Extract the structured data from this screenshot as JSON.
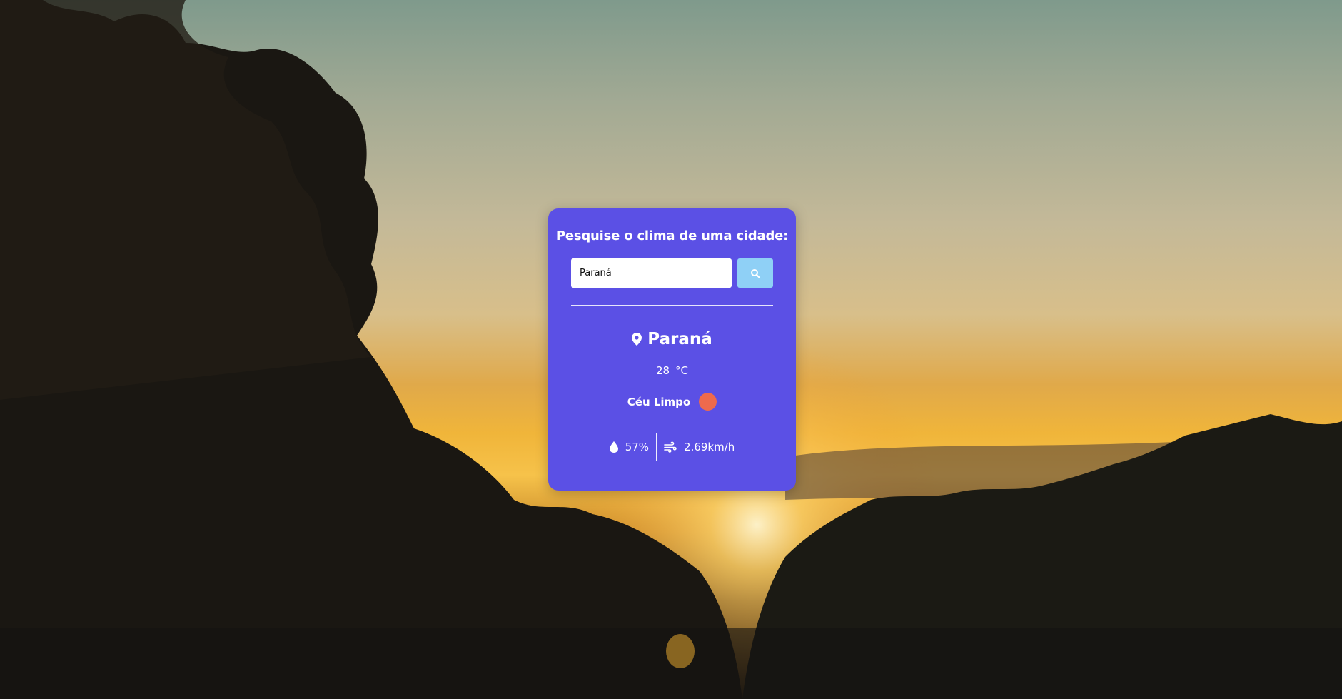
{
  "search": {
    "heading": "Pesquise o clima de uma cidade:",
    "input_value": "Paraná",
    "button_icon": "search-icon"
  },
  "weather": {
    "city": "Paraná",
    "city_icon": "location-pin-icon",
    "temperature": "28",
    "unit": "°C",
    "description": "Céu Limpo",
    "description_icon": "weather-condition-icon",
    "humidity": "57%",
    "humidity_icon": "water-drop-icon",
    "wind": "2.69km/h",
    "wind_icon": "wind-icon"
  },
  "colors": {
    "card_background": "#5b50e5",
    "search_button": "#8fd0f6",
    "condition_icon": "#ee6a4d"
  }
}
